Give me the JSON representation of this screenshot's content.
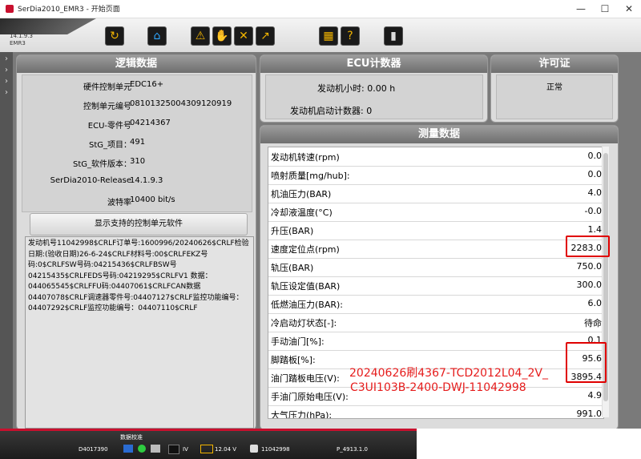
{
  "window": {
    "title": "SerDia2010_EMR3 - 开始页面",
    "minimize": "—",
    "maximize": "☐",
    "close": "✕"
  },
  "toolbar": {
    "version": "14.1.9.3",
    "variant": "EMR3"
  },
  "logic_panel": {
    "title": "逻辑数据",
    "rows": [
      {
        "label": "硬件控制单元",
        "value": "EDC16+"
      },
      {
        "label": "控制单元编号",
        "value": "08101325004309120919"
      },
      {
        "label": "ECU-零件号",
        "value": "04214367"
      },
      {
        "label": "StG_项目：",
        "value": "491"
      },
      {
        "label": "StG_软件版本：",
        "value": "310"
      },
      {
        "label": "SerDia2010-Release",
        "value": "14.1.9.3"
      },
      {
        "label": "波特率",
        "value": "10400 bit/s"
      }
    ],
    "show_button": "显示支持的控制单元软件",
    "info_text": "发动机号11042998$CRLF订单号:1600996/20240626$CRLF检验日期:(验收日期)26-6-24$CRLF材料号:00$CRLFEKZ号码:0$CRLFSW号码:04215436$CRLFBSW号04215435$CRLFEDS号码:04219295$CRLFV1 数据：044065545$CRLFFU码:04407061$CRLFCAN数据04407078$CRLF调速器零件号:04407127$CRLF监控功能编号：04407292$CRLF监控功能编号：04407110$CRLF"
  },
  "ecu_counter": {
    "title": "ECU计数器",
    "hours_label": "发动机小时: 0.00 h",
    "starts_label": "发动机启动计数器: 0"
  },
  "license": {
    "title": "许可证",
    "status": "正常"
  },
  "measure": {
    "title": "测量数据",
    "rows": [
      {
        "name": "发动机转速(rpm)",
        "value": "0.0"
      },
      {
        "name": "喷射质量[mg/hub]:",
        "value": "0.0"
      },
      {
        "name": "机油压力(BAR)",
        "value": "4.0"
      },
      {
        "name": "冷却液温度(°C)",
        "value": "-0.0"
      },
      {
        "name": "升压(BAR)",
        "value": "1.4"
      },
      {
        "name": "速度定位点(rpm)",
        "value": "2283.0"
      },
      {
        "name": "轨压(BAR)",
        "value": "750.0"
      },
      {
        "name": "轨压设定值(BAR)",
        "value": "300.0"
      },
      {
        "name": "低燃油压力(BAR):",
        "value": "6.0"
      },
      {
        "name": "冷启动灯状态[-]:",
        "value": "待命"
      },
      {
        "name": "手动油门[%]:",
        "value": "0.1"
      },
      {
        "name": "脚踏板[%]:",
        "value": "95.6"
      },
      {
        "name": "油门踏板电压(V):",
        "value": "3895.4"
      },
      {
        "name": "手油门原始电压(V):",
        "value": "4.9"
      },
      {
        "name": "大气压力(hPa):",
        "value": "991.0"
      }
    ]
  },
  "annotation": {
    "line1": "20240626刷4367-TCD2012L04_2V_",
    "line2": "C3UI103B-2400-DWJ-11042998"
  },
  "statusbar": {
    "mode": "数据校准",
    "id": "D4017390",
    "label_iv": "IV",
    "voltage": "12.04 V",
    "engine_no": "11042998",
    "project": "P_4913.1.0"
  },
  "colors": {
    "accent": "#c8102e",
    "highlight": "#e00000"
  }
}
